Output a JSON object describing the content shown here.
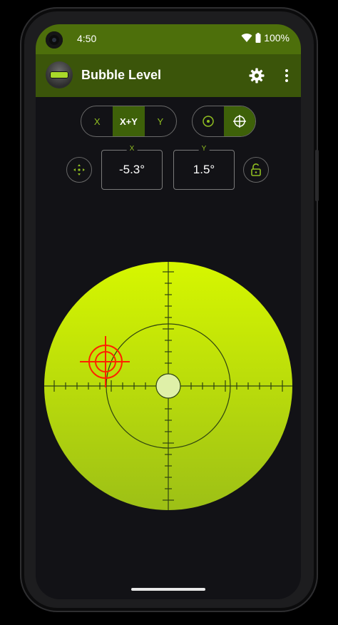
{
  "status_bar": {
    "time": "4:50",
    "battery": "100%"
  },
  "app_bar": {
    "title": "Bubble Level",
    "settings_icon": "gear-icon",
    "menu_icon": "more-vert-icon"
  },
  "axis_toggle": {
    "options": [
      "X",
      "X+Y",
      "Y"
    ],
    "selected": "X+Y"
  },
  "view_toggle": {
    "options": [
      "target-icon",
      "crosshair-icon"
    ],
    "selected": "crosshair-icon"
  },
  "readouts": {
    "x": {
      "label": "X",
      "value": "-5.3°"
    },
    "y": {
      "label": "Y",
      "value": "1.5°"
    }
  },
  "colors": {
    "accent": "#8fbd21",
    "bar": "#3b550a",
    "status": "#4d6f0b",
    "level_face": "#c8ef00",
    "marker": "#ff2200"
  }
}
